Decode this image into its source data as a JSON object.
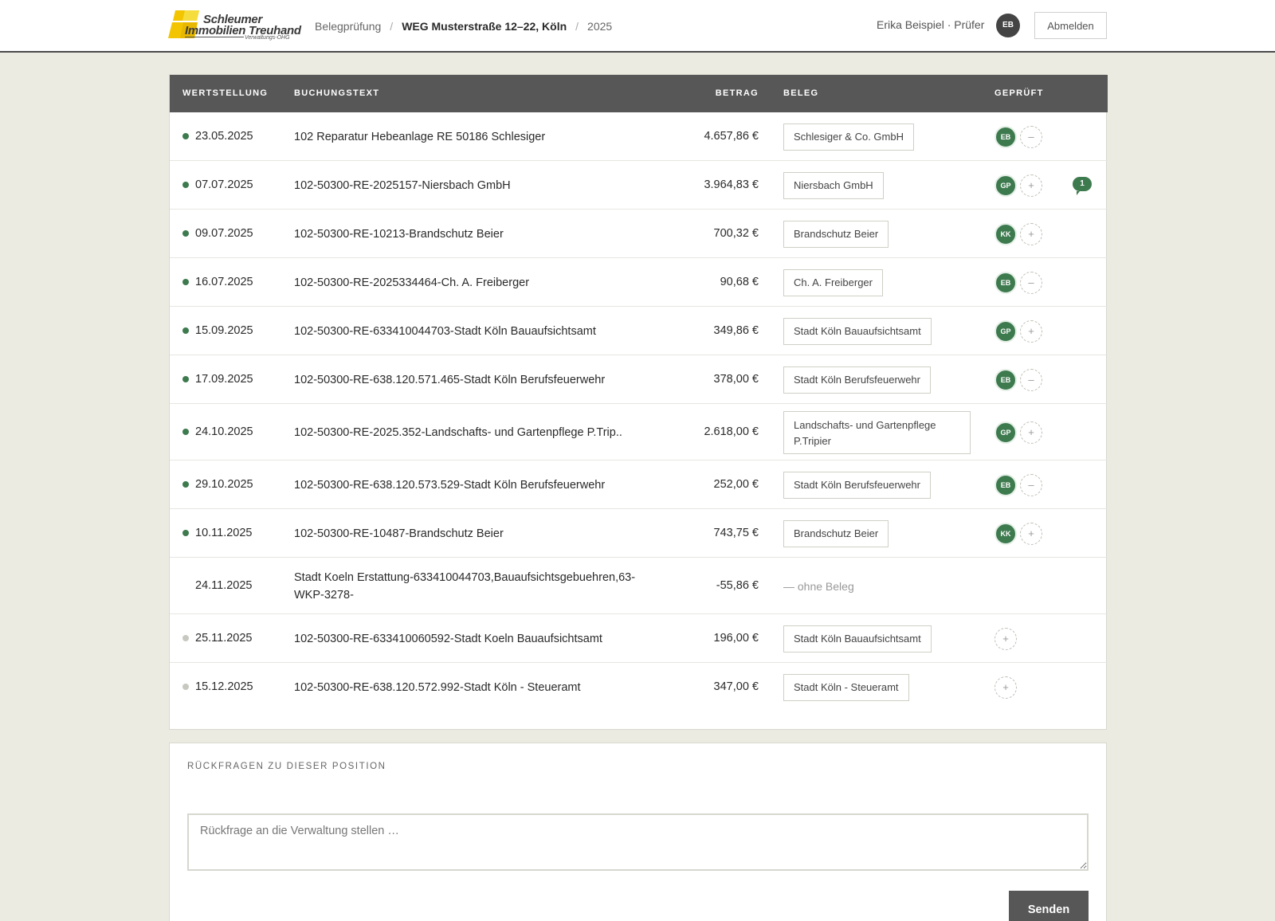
{
  "brand": {
    "line1": "Schleumer",
    "line2": "Immobilien Treuhand",
    "line3": "Verwaltungs-OHG",
    "colors": {
      "yellow": "#f2c500",
      "yellow_light": "#f6dd3e"
    }
  },
  "breadcrumb": {
    "items": [
      "Belegprüfung",
      "WEG Musterstraße 12–22, Köln",
      "2025"
    ],
    "separator": "/"
  },
  "user": {
    "label": "Erika Beispiel · Prüfer",
    "initials": "EB",
    "logout_label": "Abmelden"
  },
  "table": {
    "headers": {
      "date": "WERTSTELLUNG",
      "text": "BUCHUNGSTEXT",
      "amount": "BETRAG",
      "receipt": "BELEG",
      "checked": "GEPRÜFT"
    },
    "rows": [
      {
        "status": "checked",
        "date": "23.05.2025",
        "text": "102 Reparatur Hebeanlage RE 50186 Schlesiger",
        "amount": "4.657,86 €",
        "receipt": "Schlesiger & Co. GmbH",
        "checker": "EB",
        "toggle": "–",
        "comments": ""
      },
      {
        "status": "checked",
        "date": "07.07.2025",
        "text": "102-50300-RE-2025157-Niersbach GmbH",
        "amount": "3.964,83 €",
        "receipt": "Niersbach GmbH",
        "checker": "GP",
        "toggle": "+",
        "comments": "1"
      },
      {
        "status": "checked",
        "date": "09.07.2025",
        "text": "102-50300-RE-10213-Brandschutz Beier",
        "amount": "700,32 €",
        "receipt": "Brandschutz Beier",
        "checker": "KK",
        "toggle": "+",
        "comments": ""
      },
      {
        "status": "checked",
        "date": "16.07.2025",
        "text": "102-50300-RE-2025334464-Ch. A. Freiberger",
        "amount": "90,68 €",
        "receipt": "Ch. A. Freiberger",
        "checker": "EB",
        "toggle": "–",
        "comments": ""
      },
      {
        "status": "checked",
        "date": "15.09.2025",
        "text": "102-50300-RE-633410044703-Stadt Köln Bauaufsichtsamt",
        "amount": "349,86 €",
        "receipt": "Stadt Köln Bauaufsichtsamt",
        "checker": "GP",
        "toggle": "+",
        "comments": ""
      },
      {
        "status": "checked",
        "date": "17.09.2025",
        "text": "102-50300-RE-638.120.571.465-Stadt Köln Berufsfeuerwehr",
        "amount": "378,00 €",
        "receipt": "Stadt Köln Berufsfeuerwehr",
        "checker": "EB",
        "toggle": "–",
        "comments": ""
      },
      {
        "status": "checked",
        "date": "24.10.2025",
        "text": "102-50300-RE-2025.352-Landschafts- und Gartenpflege P.Trip..",
        "amount": "2.618,00 €",
        "receipt": "Landschafts- und Gartenpflege P.Tripier",
        "checker": "GP",
        "toggle": "+",
        "comments": "",
        "tall": true
      },
      {
        "status": "checked",
        "date": "29.10.2025",
        "text": "102-50300-RE-638.120.573.529-Stadt Köln Berufsfeuerwehr",
        "amount": "252,00 €",
        "receipt": "Stadt Köln Berufsfeuerwehr",
        "checker": "EB",
        "toggle": "–",
        "comments": ""
      },
      {
        "status": "checked",
        "date": "10.11.2025",
        "text": "102-50300-RE-10487-Brandschutz Beier",
        "amount": "743,75 €",
        "receipt": "Brandschutz Beier",
        "checker": "KK",
        "toggle": "+",
        "comments": ""
      },
      {
        "status": "none",
        "date": "24.11.2025",
        "text": "Stadt Koeln Erstattung-633410044703,Bauaufsichtsgebuehren,63-WKP-3278-",
        "amount": "-55,86 €",
        "receipt": "",
        "no_receipt": "— ohne Beleg",
        "checker": "",
        "toggle": "",
        "comments": "",
        "tall": true
      },
      {
        "status": "pending",
        "date": "25.11.2025",
        "text": "102-50300-RE-633410060592-Stadt Koeln Bauaufsichtsamt",
        "amount": "196,00 €",
        "receipt": "Stadt Köln Bauaufsichtsamt",
        "checker": "",
        "toggle": "+",
        "comments": ""
      },
      {
        "status": "pending",
        "date": "15.12.2025",
        "text": "102-50300-RE-638.120.572.992-Stadt Köln - Steueramt",
        "amount": "347,00 €",
        "receipt": "Stadt Köln - Steueramt",
        "checker": "",
        "toggle": "+",
        "comments": ""
      }
    ]
  },
  "questions": {
    "title": "RÜCKFRAGEN ZU DIESER POSITION",
    "placeholder": "Rückfrage an die Verwaltung stellen …",
    "send_label": "Senden"
  },
  "colors": {
    "header_bg": "#575757",
    "accent_green": "#3d7a4e",
    "page_bg": "#ecebe1"
  },
  "icons": {
    "remove": "minus-icon",
    "add": "plus-icon",
    "comment": "comment-icon"
  }
}
